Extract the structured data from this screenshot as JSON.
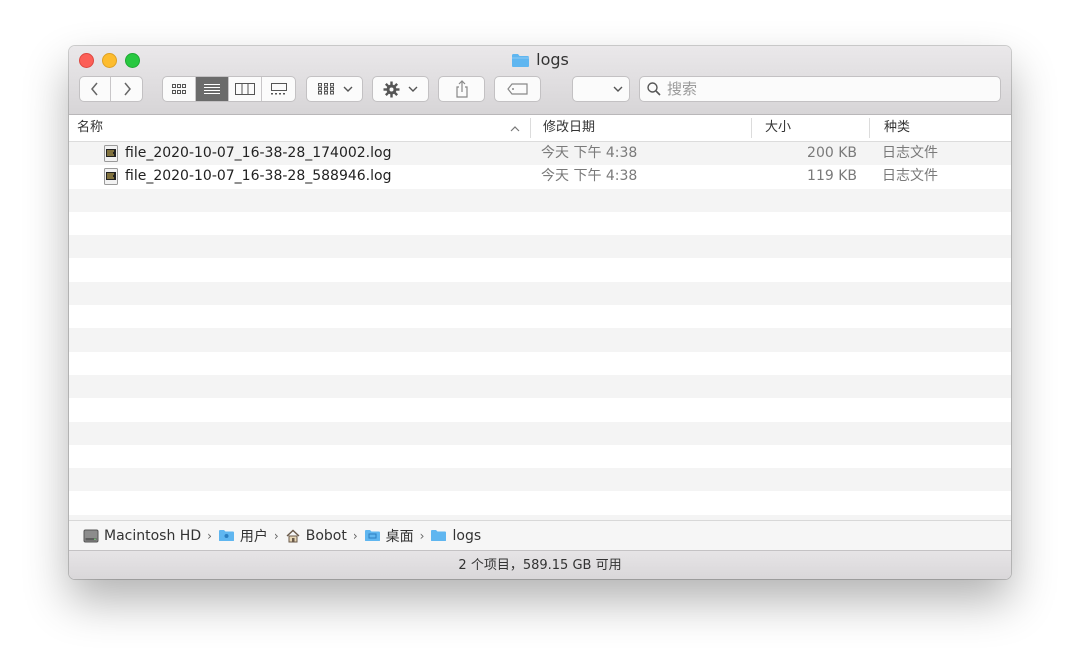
{
  "window": {
    "title": "logs"
  },
  "toolbar": {
    "back_icon": "chevron-left-icon",
    "forward_icon": "chevron-right-icon",
    "view_modes": [
      "icon-view",
      "list-view",
      "column-view",
      "gallery-view"
    ],
    "active_view": "list-view",
    "search_placeholder": "搜索"
  },
  "columns": {
    "name": "名称",
    "date": "修改日期",
    "size": "大小",
    "kind": "种类"
  },
  "files": [
    {
      "name": "file_2020-10-07_16-38-28_174002.log",
      "date": "今天 下午 4:38",
      "size": "200 KB",
      "kind": "日志文件"
    },
    {
      "name": "file_2020-10-07_16-38-28_588946.log",
      "date": "今天 下午 4:38",
      "size": "119 KB",
      "kind": "日志文件"
    }
  ],
  "path": [
    {
      "label": "Macintosh HD",
      "icon": "hard-drive-icon"
    },
    {
      "label": "用户",
      "icon": "users-folder-icon"
    },
    {
      "label": "Bobot",
      "icon": "home-icon"
    },
    {
      "label": "桌面",
      "icon": "desktop-folder-icon"
    },
    {
      "label": "logs",
      "icon": "folder-icon"
    }
  ],
  "status": "2 个项目，589.15 GB 可用",
  "colors": {
    "folder": "#5fb6f0",
    "close": "#fc5f57",
    "minimize": "#fdbc2e",
    "maximize": "#28c840"
  }
}
